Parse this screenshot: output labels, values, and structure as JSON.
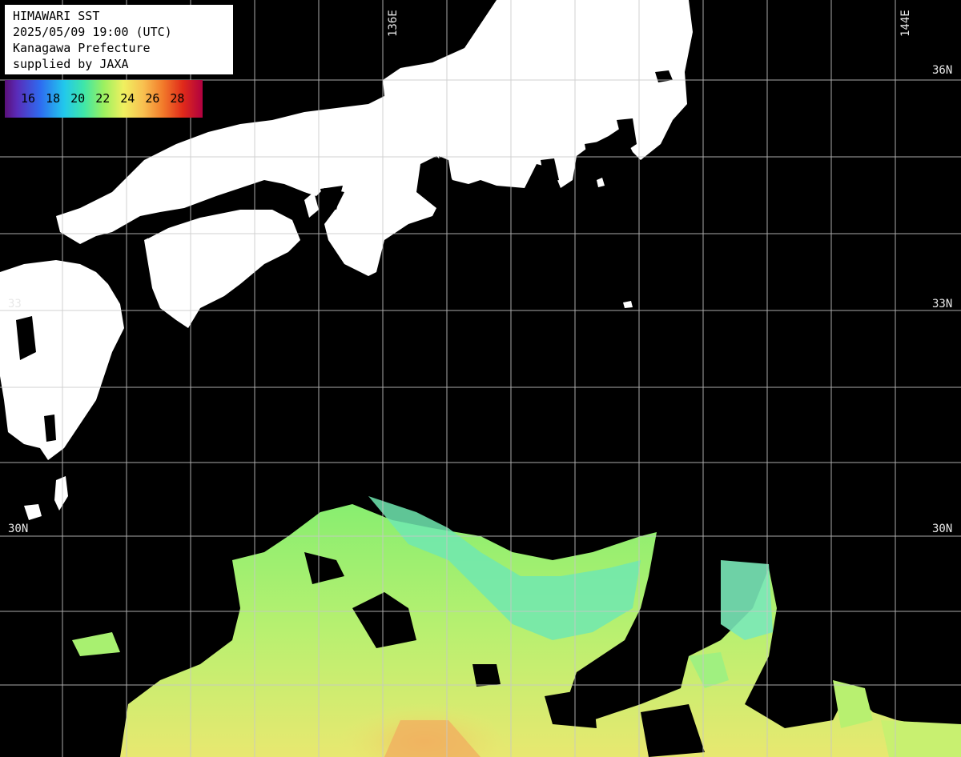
{
  "info": {
    "line1": "HIMAWARI SST",
    "line2": "2025/05/09 19:00 (UTC)",
    "line3": "Kanagawa Prefecture",
    "line4": "supplied by JAXA"
  },
  "legend": {
    "ticks": [
      "16",
      "18",
      "20",
      "22",
      "24",
      "26",
      "28"
    ]
  },
  "grid_labels": {
    "lon_136": "136E",
    "lon_144": "144E",
    "lat_36_right": "36N",
    "lat_33_right": "33N",
    "lat_33_left": "33",
    "lat_30_right": "30N",
    "lat_30_left": "30N"
  },
  "colors": {
    "land": "#ffffff",
    "no_data": "#000000",
    "grid": "#c8c8c8"
  }
}
